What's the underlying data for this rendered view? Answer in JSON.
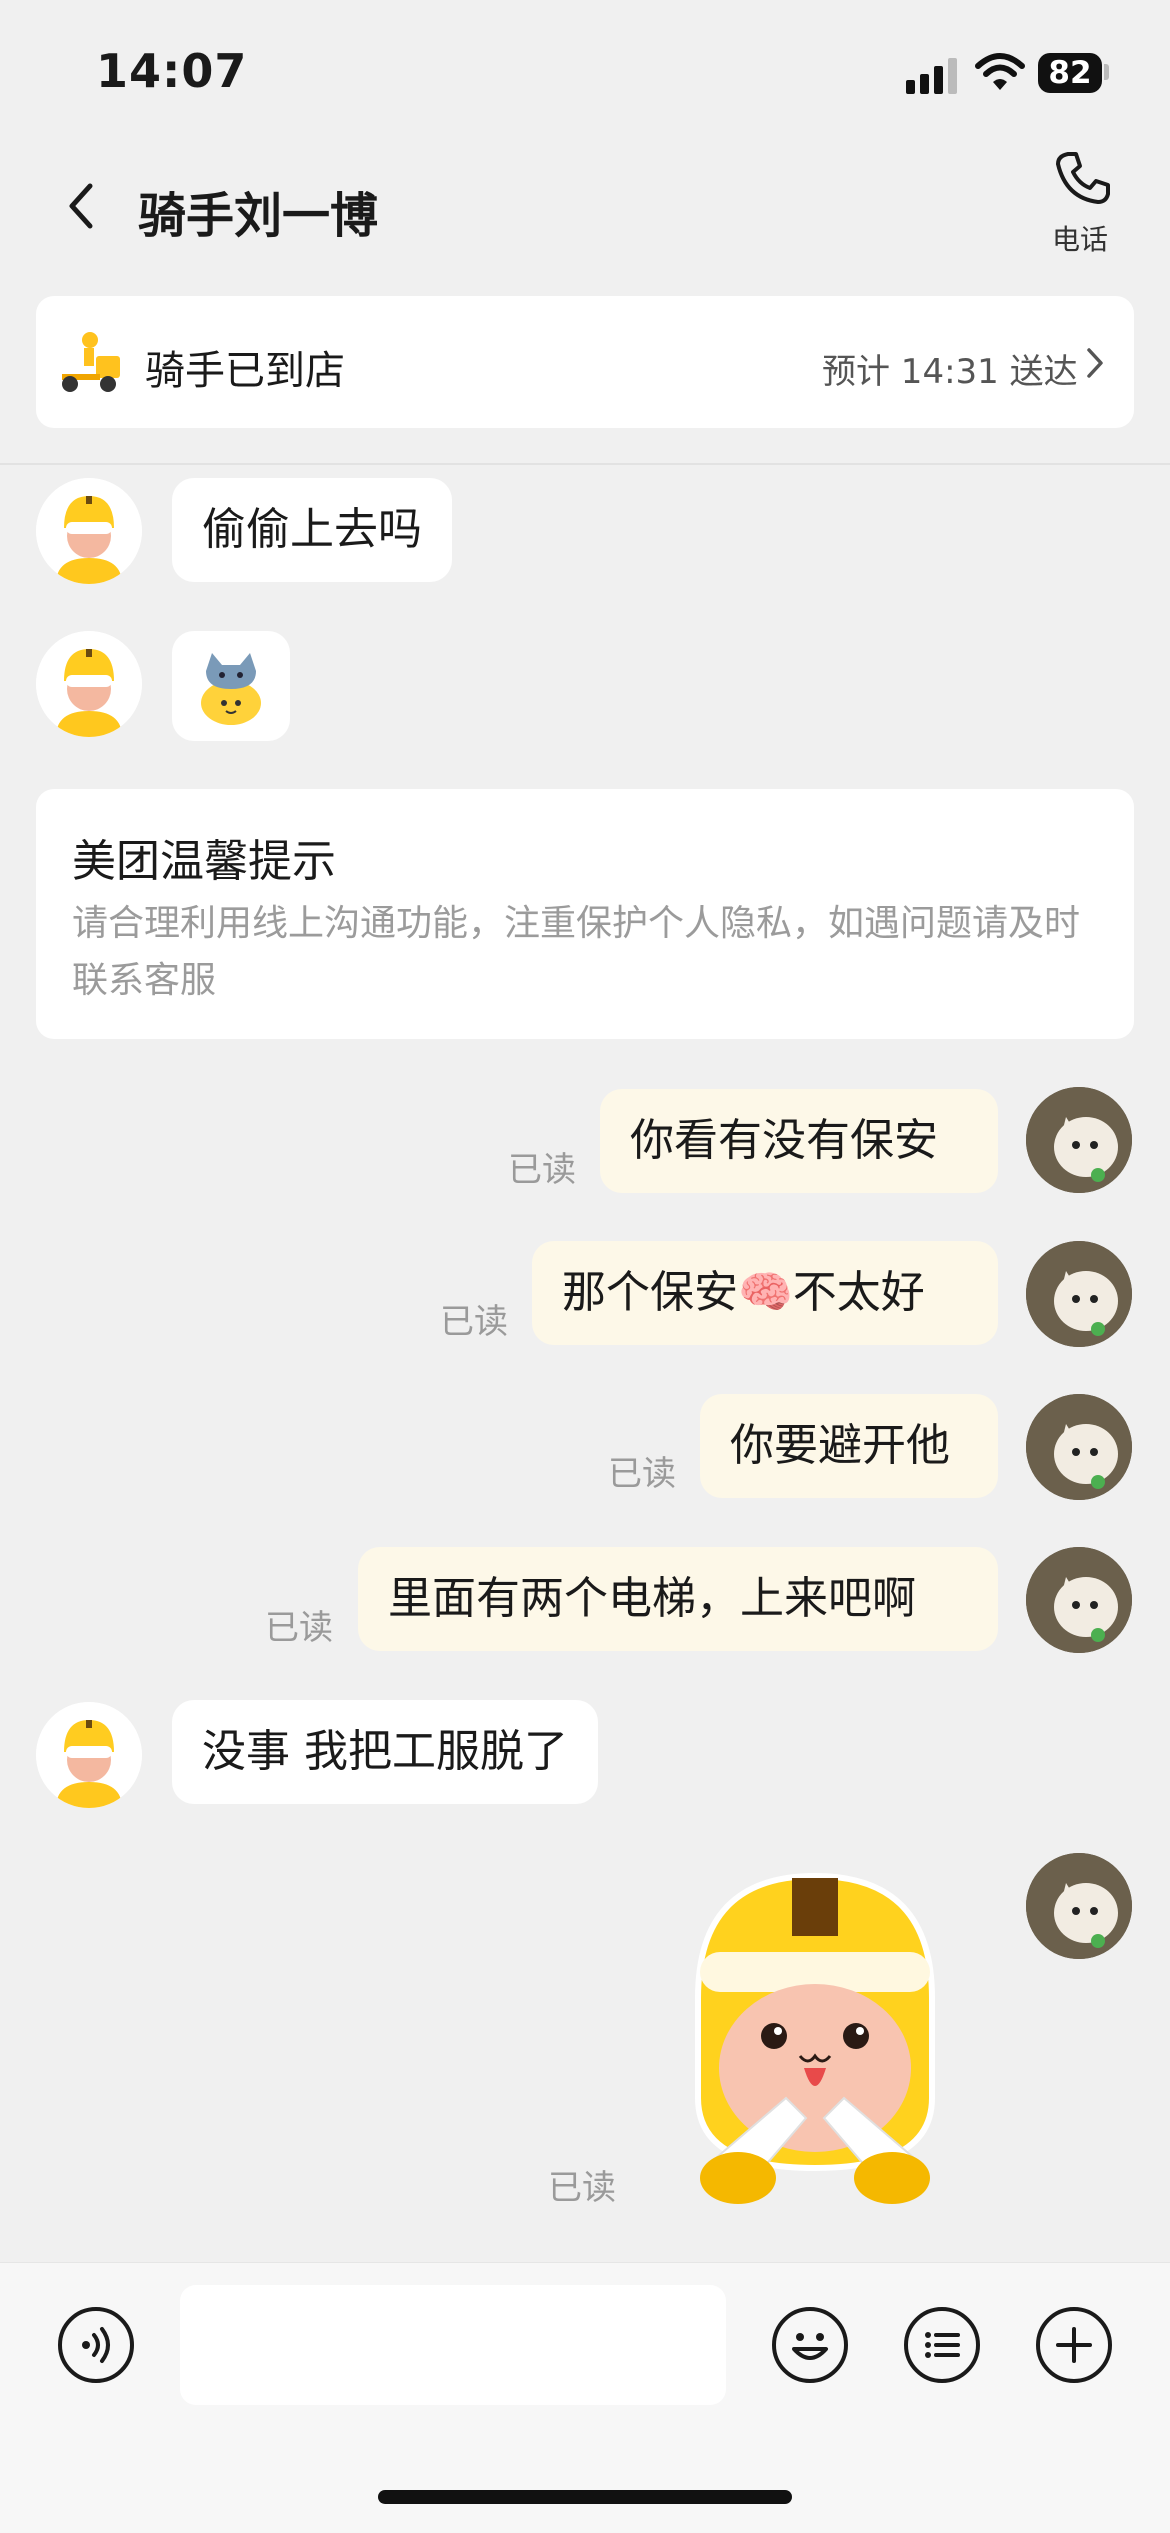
{
  "status_bar": {
    "time": "14:07",
    "battery": "82"
  },
  "header": {
    "title": "骑手刘一博",
    "call_label": "电话"
  },
  "delivery": {
    "status": "骑手已到店",
    "eta": "预计 14:31 送达"
  },
  "notice": {
    "title": "美团温馨提示",
    "body": "请合理利用线上沟通功能，注重保护个人隐私，如遇问题请及时联系客服"
  },
  "messages": [
    {
      "from": "rider",
      "text": "偷偷上去吗"
    },
    {
      "from": "rider",
      "sticker": "cat-sticker-icon"
    },
    {
      "from": "user",
      "text": "你看有没有保安",
      "status": "已读"
    },
    {
      "from": "user",
      "text_before": "那个保安",
      "emoji": "🧠",
      "text_after": "不太好",
      "status": "已读"
    },
    {
      "from": "user",
      "text": "你要避开他",
      "status": "已读"
    },
    {
      "from": "user",
      "text": "里面有两个电梯，上来吧啊",
      "status": "已读"
    },
    {
      "from": "rider",
      "text": "没事 我把工服脱了"
    },
    {
      "from": "user",
      "sticker": "meituan-rider-sticker-icon",
      "status": "已读"
    }
  ],
  "input": {
    "placeholder": ""
  },
  "colors": {
    "brand_yellow": "#ffd21e",
    "user_bubble": "#fdf8e8",
    "background": "#f0f0f0"
  }
}
